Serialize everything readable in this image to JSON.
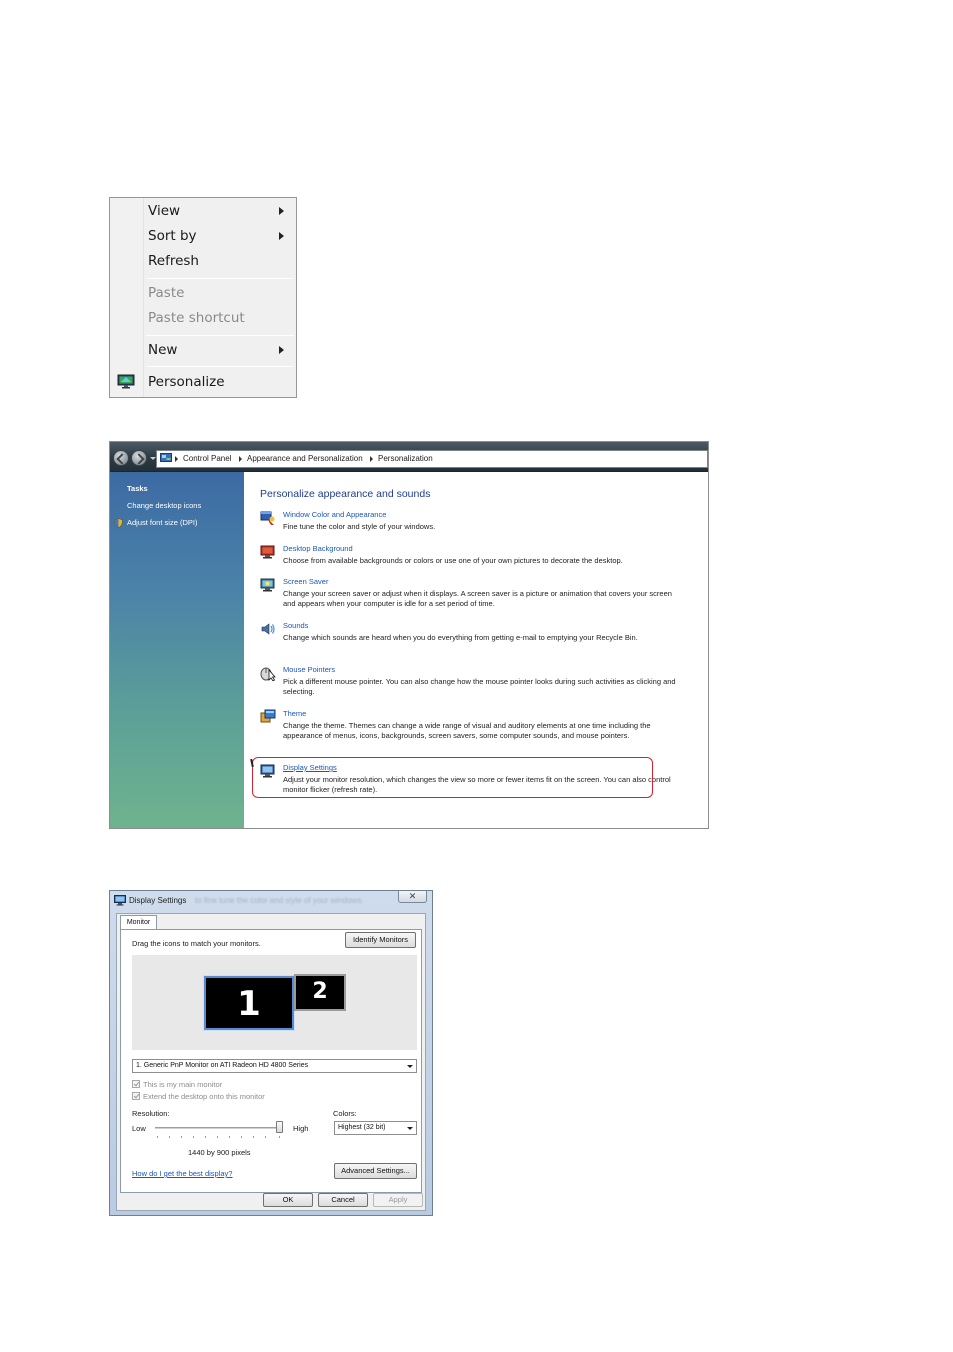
{
  "context_menu": {
    "items": [
      {
        "label": "View",
        "submenu": true,
        "disabled": false
      },
      {
        "label": "Sort by",
        "submenu": true,
        "disabled": false
      },
      {
        "label": "Refresh",
        "submenu": false,
        "disabled": false
      },
      {
        "label": "Paste",
        "submenu": false,
        "disabled": true
      },
      {
        "label": "Paste shortcut",
        "submenu": false,
        "disabled": true
      },
      {
        "label": "New",
        "submenu": true,
        "disabled": false
      },
      {
        "label": "Personalize",
        "submenu": false,
        "disabled": false,
        "icon": "personalize-icon"
      }
    ]
  },
  "control_panel": {
    "breadcrumb": [
      "Control Panel",
      "Appearance and Personalization",
      "Personalization"
    ],
    "sidebar": {
      "title": "Tasks",
      "links": [
        "Change desktop icons",
        "Adjust font size (DPI)"
      ]
    },
    "heading": "Personalize appearance and sounds",
    "entries": [
      {
        "title": "Window Color and Appearance",
        "desc": "Fine tune the color and style of your windows.",
        "icon": "window-color-icon"
      },
      {
        "title": "Desktop Background",
        "desc": "Choose from available backgrounds or colors or use one of your own pictures to decorate the desktop.",
        "icon": "desktop-background-icon"
      },
      {
        "title": "Screen Saver",
        "desc": "Change your screen saver or adjust when it displays. A screen saver is a picture or animation that covers your screen and appears when your computer is idle for a set period of time.",
        "icon": "screen-saver-icon"
      },
      {
        "title": "Sounds",
        "desc": "Change which sounds are heard when you do everything from getting e-mail to emptying your Recycle Bin.",
        "icon": "sounds-icon"
      },
      {
        "title": "Mouse Pointers",
        "desc": "Pick a different mouse pointer. You can also change how the mouse pointer looks during such activities as clicking and selecting.",
        "icon": "mouse-pointer-icon"
      },
      {
        "title": "Theme",
        "desc": "Change the theme. Themes can change a wide range of visual and auditory elements at one time including the appearance of menus, icons, backgrounds, screen savers, some computer sounds, and mouse pointers.",
        "icon": "theme-icon"
      },
      {
        "title": "Display Settings",
        "desc": "Adjust your monitor resolution, which changes the view so more or fewer items fit on the screen. You can also control monitor flicker (refresh rate).",
        "icon": "display-settings-icon"
      }
    ],
    "highlight_color": "#d32232"
  },
  "display_settings": {
    "title": "Display Settings",
    "title_ghost": "to fine tune the color and style of your windows.",
    "close_glyph": "✕",
    "tab": "Monitor",
    "instruction": "Drag the icons to match your monitors.",
    "identify_button": "Identify Monitors",
    "monitor_1": "1",
    "monitor_2": "2",
    "monitor_select": "1. Generic PnP Monitor on ATI Radeon HD 4800 Series",
    "checkbox_main": "This is my main monitor",
    "checkbox_extend": "Extend the desktop onto this monitor",
    "resolution_label": "Resolution:",
    "low_label": "Low",
    "high_label": "High",
    "resolution_value": "1440 by 900 pixels",
    "colors_label": "Colors:",
    "colors_select": "Highest (32 bit)",
    "help_link": "How do I get the best display?",
    "advanced_button": "Advanced Settings...",
    "ok_button": "OK",
    "cancel_button": "Cancel",
    "apply_button": "Apply"
  }
}
